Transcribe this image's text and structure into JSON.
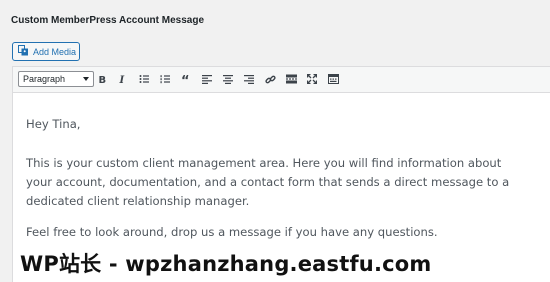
{
  "section_title": "Custom MemberPress Account Message",
  "add_media": {
    "label": "Add Media",
    "icon": "media-icon"
  },
  "toolbar": {
    "format_value": "Paragraph",
    "buttons": [
      "bold-icon",
      "italic-icon",
      "bulleted-list-icon",
      "numbered-list-icon",
      "blockquote-icon",
      "align-left-icon",
      "align-center-icon",
      "align-right-icon",
      "link-icon",
      "read-more-icon",
      "fullscreen-icon",
      "toolbar-toggle-icon"
    ]
  },
  "content": {
    "greeting": "Hey Tina,",
    "paragraph1": "This is your custom client management area. Here you will find information about your account, documentation, and a contact form that sends a direct message to a dedicated client relationship manager.",
    "paragraph2": "Feel free to look around, drop us a message if you have any questions."
  },
  "watermark": "WP站长 - wpzhanzhang.eastfu.com"
}
